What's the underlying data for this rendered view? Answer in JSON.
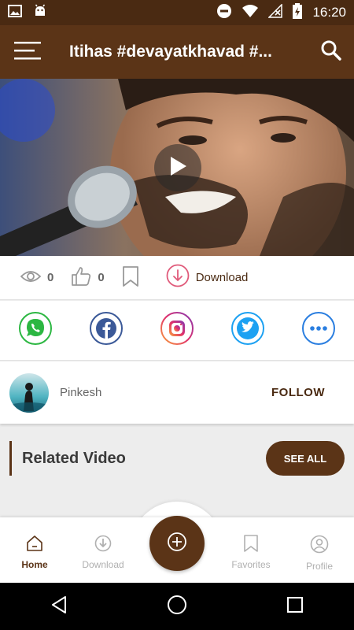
{
  "colors": {
    "brand": "#5b3417",
    "status_bar": "#4a2a12",
    "accent_download": "#e05a7a"
  },
  "status_bar": {
    "time": "16:20",
    "left_icons": [
      "image-icon",
      "android-icon"
    ],
    "right_icons": [
      "dnd-icon",
      "wifi-icon",
      "no-signal-icon",
      "battery-charging-icon"
    ]
  },
  "header": {
    "title": "Itihas #devayatkhavad #...",
    "menu_icon": "menu-icon",
    "search_icon": "search-icon"
  },
  "video": {
    "play_icon": "play-icon"
  },
  "stats": {
    "views": "0",
    "likes": "0",
    "download_label": "Download"
  },
  "share": [
    "whatsapp-icon",
    "facebook-icon",
    "instagram-icon",
    "twitter-icon",
    "more-icon"
  ],
  "user": {
    "name": "Pinkesh",
    "follow_label": "FOLLOW"
  },
  "related": {
    "title": "Related Video",
    "see_all": "SEE ALL"
  },
  "bottom_nav": {
    "home": "Home",
    "download": "Download",
    "favorites": "Favorites",
    "profile": "Profile",
    "active": "Home"
  }
}
